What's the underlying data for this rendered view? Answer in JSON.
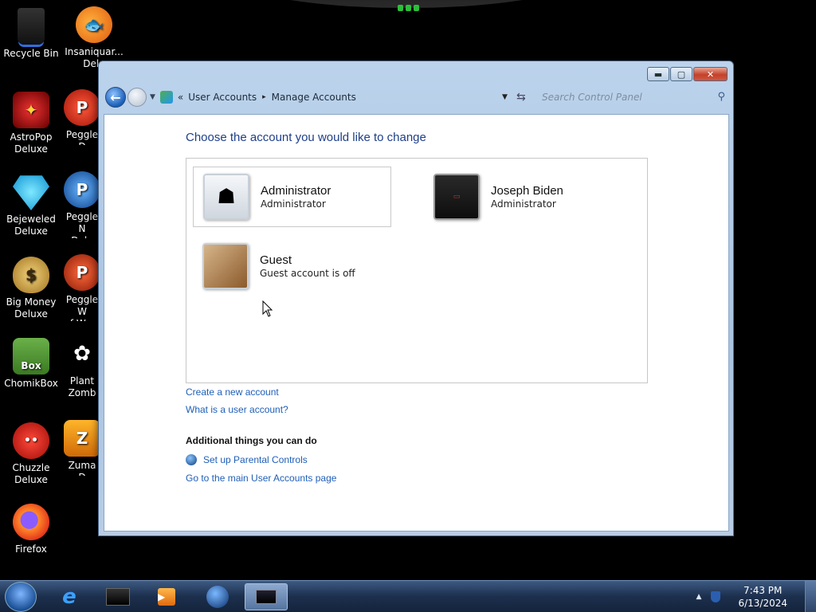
{
  "desktop": {
    "icons": [
      {
        "label": "Recycle Bin"
      },
      {
        "label": "Insaniquar...\nDelu"
      },
      {
        "label": "AstroPop\nDeluxe"
      },
      {
        "label": "Peggle D"
      },
      {
        "label": "Bejeweled\nDeluxe"
      },
      {
        "label": "Peggle N\nDelu"
      },
      {
        "label": "Big Money\nDeluxe"
      },
      {
        "label": "Peggle W\nof Warc"
      },
      {
        "label": "ChomikBox"
      },
      {
        "label": "Plant\nZomb"
      },
      {
        "label": "Chuzzle\nDeluxe"
      },
      {
        "label": "Zuma D"
      },
      {
        "label": "Firefox"
      }
    ]
  },
  "window": {
    "controls": {
      "minimize": "▬",
      "maximize": "▢",
      "close": "✕"
    },
    "breadcrumb": {
      "prefix": "«",
      "items": [
        "User Accounts",
        "Manage Accounts"
      ],
      "separator": "▸"
    },
    "search": {
      "placeholder": "Search Control Panel"
    }
  },
  "main": {
    "heading": "Choose the account you would like to change",
    "accounts": [
      {
        "name": "Administrator",
        "role": "Administrator",
        "icon": "robot-avatar-icon"
      },
      {
        "name": "Joseph Biden",
        "role": "Administrator",
        "icon": "dark-avatar-icon"
      },
      {
        "name": "Guest",
        "role": "Guest account is off",
        "icon": "briefcase-avatar-icon"
      }
    ],
    "links": {
      "create": "Create a new account",
      "what_is": "What is a user account?"
    },
    "additional": {
      "heading": "Additional things you can do",
      "parental": "Set up Parental Controls",
      "main_page": "Go to the main User Accounts page"
    }
  },
  "taskbar": {
    "time": "7:43 PM",
    "date": "6/13/2024"
  }
}
